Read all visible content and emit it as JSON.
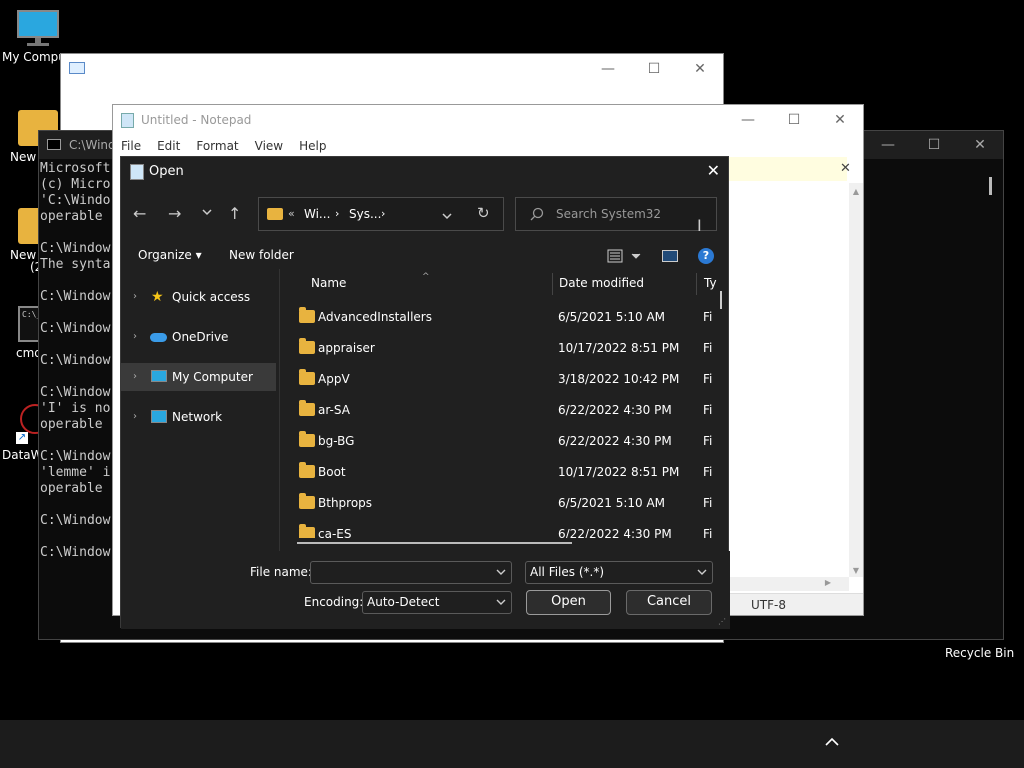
{
  "desktop": {
    "icons": [
      {
        "label": "My Compu",
        "icon": "monitor-icon"
      },
      {
        "label": "New f",
        "icon": "folder-icon"
      },
      {
        "label": "New f",
        "icon": "folder-icon"
      },
      {
        "label": "(2",
        "icon": ""
      },
      {
        "label": "cmd",
        "icon": "terminal-icon"
      },
      {
        "label": "DataW",
        "icon": "shortcut-icon"
      }
    ],
    "recycle_bin": "Recycle Bin"
  },
  "cmd": {
    "title": "C:\\Wind",
    "lines": [
      "Microsoft",
      "(c) Micro",
      "'C:\\Windo",
      "operable",
      "",
      "C:\\Window",
      "The synta",
      "",
      "C:\\Window",
      "",
      "C:\\Window",
      "",
      "C:\\Window",
      "",
      "C:\\Window",
      "'I' is no",
      "operable",
      "",
      "C:\\Window",
      "'lemme' i",
      "operable",
      "",
      "C:\\Window",
      "",
      "C:\\Window"
    ]
  },
  "notepad": {
    "title": "Untitled - Notepad",
    "menu": [
      "File",
      "Edit",
      "Format",
      "View",
      "Help"
    ],
    "status_encoding": "UTF-8"
  },
  "dialog": {
    "title": "Open",
    "breadcrumb": [
      "Wi...",
      "Sys..."
    ],
    "search_placeholder": "Search System32",
    "organize_label": "Organize",
    "new_folder_label": "New folder",
    "nav": [
      {
        "label": "Quick access",
        "icon": "star-icon"
      },
      {
        "label": "OneDrive",
        "icon": "cloud-icon"
      },
      {
        "label": "My Computer",
        "icon": "computer-icon"
      },
      {
        "label": "Network",
        "icon": "network-icon"
      }
    ],
    "columns": {
      "name": "Name",
      "date": "Date modified",
      "type": "Ty"
    },
    "files": [
      {
        "name": "AdvancedInstallers",
        "date": "6/5/2021 5:10 AM",
        "type": "Fi"
      },
      {
        "name": "appraiser",
        "date": "10/17/2022 8:51 PM",
        "type": "Fi"
      },
      {
        "name": "AppV",
        "date": "3/18/2022 10:42 PM",
        "type": "Fi"
      },
      {
        "name": "ar-SA",
        "date": "6/22/2022 4:30 PM",
        "type": "Fi"
      },
      {
        "name": "bg-BG",
        "date": "6/22/2022 4:30 PM",
        "type": "Fi"
      },
      {
        "name": "Boot",
        "date": "10/17/2022 8:51 PM",
        "type": "Fi"
      },
      {
        "name": "Bthprops",
        "date": "6/5/2021 5:10 AM",
        "type": "Fi"
      },
      {
        "name": "ca-ES",
        "date": "6/22/2022 4:30 PM",
        "type": "Fi"
      }
    ],
    "file_name_label": "File name:",
    "file_name_value": "",
    "file_type_value": "All Files  (*.*)",
    "encoding_label": "Encoding:",
    "encoding_value": "Auto-Detect",
    "open_label": "Open",
    "cancel_label": "Cancel"
  },
  "colors": {
    "accent": "#0078d4",
    "folder": "#e8b33f",
    "dialog_bg": "#202020"
  }
}
